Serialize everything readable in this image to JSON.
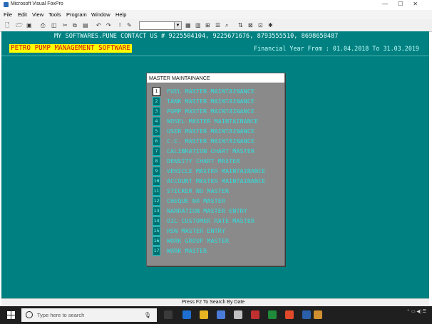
{
  "window": {
    "title": "Microsoft Visual FoxPro",
    "controls": [
      "—",
      "☐",
      "✕"
    ]
  },
  "menubar": [
    "File",
    "Edit",
    "View",
    "Tools",
    "Program",
    "Window",
    "Help"
  ],
  "header": {
    "contact": "MY SOFTWARES.PUNE CONTACT US # 9225504104, 9225671676, 8793555510, 8698650487",
    "brand": "PETRO PUMP MANAGEMENT SOFTWARE",
    "financial_year": "Financial Year From : 01.04.2018 To 31.03.2019"
  },
  "dialog": {
    "title": "MASTER MAINTAINANCE",
    "items": [
      {
        "num": "1",
        "label": "FUEL MASTER MAINTAINANCE"
      },
      {
        "num": "2",
        "label": "TANK MASTER MAINTAINANCE"
      },
      {
        "num": "3",
        "label": "PUMP MASTER MAINTAINANCE"
      },
      {
        "num": "4",
        "label": "NOSEL MASTER MAINTAINANCE"
      },
      {
        "num": "5",
        "label": "USER MASTER MAINTAINANCE"
      },
      {
        "num": "6",
        "label": "C.C. MASTER MAINTAINANCE"
      },
      {
        "num": "7",
        "label": "CALIBRATION CHART MASTER"
      },
      {
        "num": "8",
        "label": "DENSITY CHART MASTER"
      },
      {
        "num": "9",
        "label": "VEHICLE MASTER MAINTAINANCE"
      },
      {
        "num": "10",
        "label": "ACCOUNT MASTER MAINTAINANCE"
      },
      {
        "num": "11",
        "label": "STICKER NO MASTER"
      },
      {
        "num": "12",
        "label": "CHEQUE NO MASTER"
      },
      {
        "num": "13",
        "label": "NARRATION MASTER ENTRY"
      },
      {
        "num": "14",
        "label": "OIL CUSTOMER RATE MASTER"
      },
      {
        "num": "15",
        "label": "HSN MASTER ENTRY"
      },
      {
        "num": "16",
        "label": "WORK GROUP MASTER"
      },
      {
        "num": "17",
        "label": "WORK MASTER"
      }
    ]
  },
  "status": {
    "text": "Press F2 To Search By Date"
  },
  "taskbar": {
    "search_placeholder": "Type here to search"
  },
  "colors": {
    "desktop": "#008080",
    "brand_bg": "#ffff00",
    "brand_fg": "#d01010",
    "menu_text": "#2fe0e0"
  }
}
